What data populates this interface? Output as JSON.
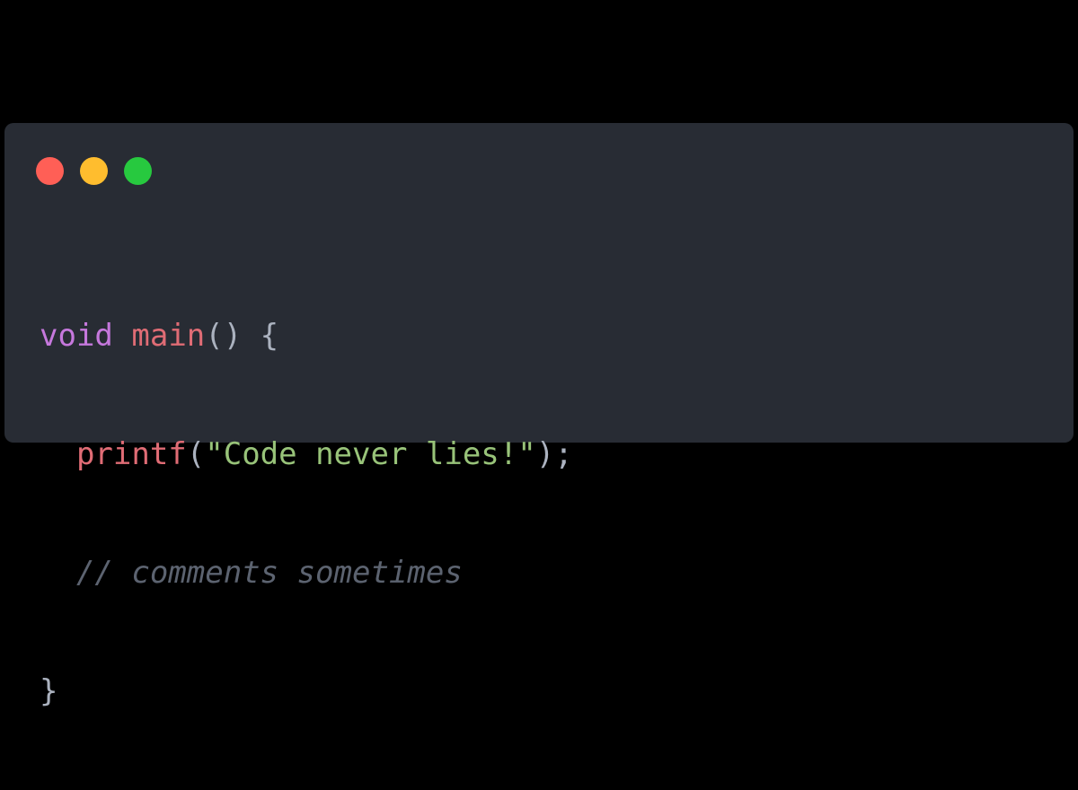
{
  "window": {
    "background": "#282c34",
    "controls": [
      {
        "name": "close-dot",
        "color": "#ff5f56"
      },
      {
        "name": "minimize-dot",
        "color": "#ffbd2e"
      },
      {
        "name": "maximize-dot",
        "color": "#27c93f"
      }
    ]
  },
  "colors": {
    "keyword": "#c678dd",
    "function": "#e06c75",
    "string": "#98c379",
    "comment": "#5c6370",
    "punctuation": "#abb2bf"
  },
  "code": {
    "line1": {
      "keyword": "void",
      "space": " ",
      "func": "main",
      "rest": "() {"
    },
    "line2": {
      "indent": "  ",
      "func": "printf",
      "open": "(",
      "string": "\"Code never lies!\"",
      "close": ");"
    },
    "line3": {
      "indent": "  ",
      "comment": "// comments sometimes"
    },
    "line4": {
      "brace": "}"
    }
  }
}
